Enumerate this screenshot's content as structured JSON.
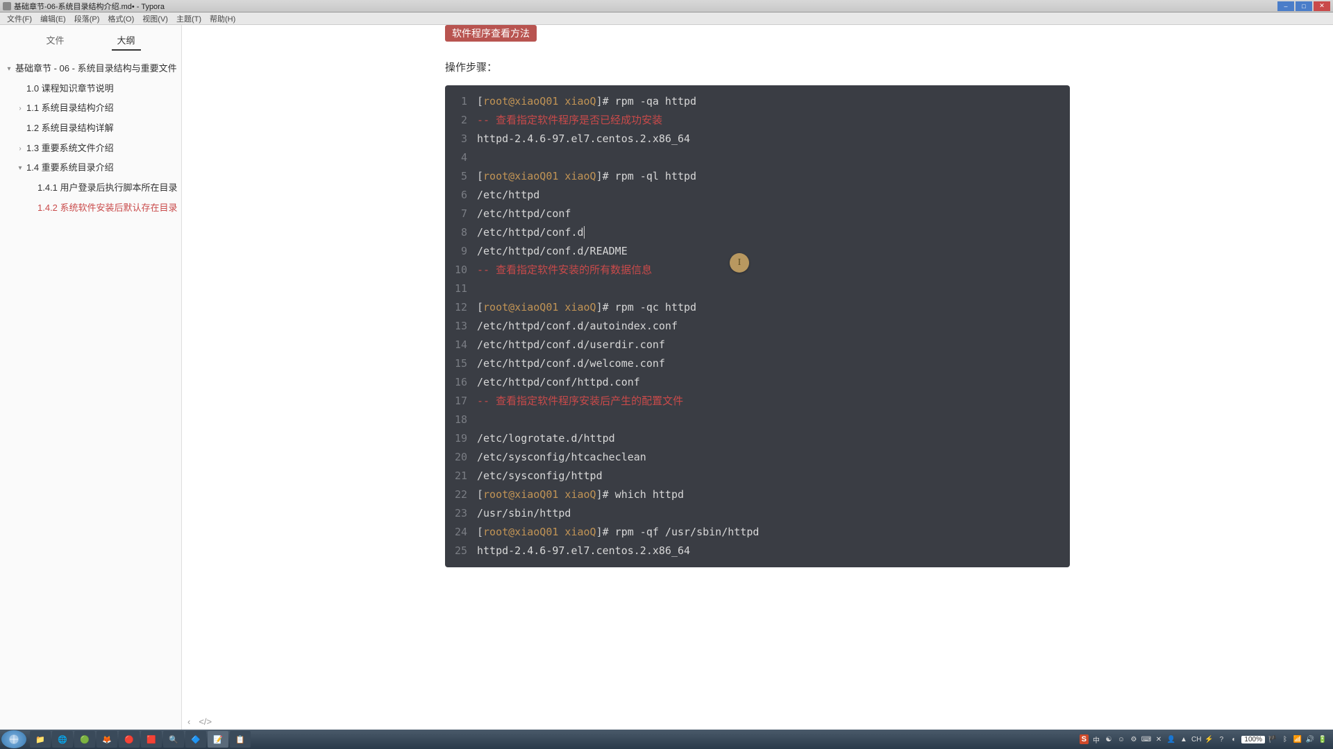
{
  "window": {
    "title": "基础章节-06-系统目录结构介绍.md• - Typora"
  },
  "menubar": [
    "文件(F)",
    "编辑(E)",
    "段落(P)",
    "格式(O)",
    "视图(V)",
    "主题(T)",
    "帮助(H)"
  ],
  "sidebar": {
    "tabs": {
      "files": "文件",
      "outline": "大纲"
    },
    "outline": [
      {
        "text": "基础章节 - 06 - 系统目录结构与重要文件",
        "level": 0,
        "arrow": "▾"
      },
      {
        "text": "1.0 课程知识章节说明",
        "level": 1,
        "arrow": ""
      },
      {
        "text": "1.1 系统目录结构介绍",
        "level": 1,
        "arrow": "›"
      },
      {
        "text": "1.2 系统目录结构详解",
        "level": 1,
        "arrow": ""
      },
      {
        "text": "1.3 重要系统文件介绍",
        "level": 1,
        "arrow": "›"
      },
      {
        "text": "1.4 重要系统目录介绍",
        "level": 1,
        "arrow": "▾"
      },
      {
        "text": "1.4.1 用户登录后执行脚本所在目录",
        "level": 2,
        "arrow": ""
      },
      {
        "text": "1.4.2 系统软件安装后默认存在目录",
        "level": 2,
        "arrow": "",
        "active": true
      }
    ]
  },
  "editor": {
    "badge": "软件程序查看方法",
    "steps_label": "操作步骤：",
    "cursor_badge": "I",
    "code_lines": [
      {
        "n": 1,
        "type": "prompt",
        "cmd": "rpm -qa httpd"
      },
      {
        "n": 2,
        "type": "comment",
        "text": "-- 查看指定软件程序是否已经成功安装"
      },
      {
        "n": 3,
        "type": "plain",
        "text": "httpd-2.4.6-97.el7.centos.2.x86_64"
      },
      {
        "n": 4,
        "type": "plain",
        "text": ""
      },
      {
        "n": 5,
        "type": "prompt",
        "cmd": "rpm -ql httpd"
      },
      {
        "n": 6,
        "type": "plain",
        "text": "/etc/httpd"
      },
      {
        "n": 7,
        "type": "plain",
        "text": "/etc/httpd/conf"
      },
      {
        "n": 8,
        "type": "plain",
        "text": "/etc/httpd/conf.d",
        "cursor": true
      },
      {
        "n": 9,
        "type": "plain",
        "text": "/etc/httpd/conf.d/README"
      },
      {
        "n": 10,
        "type": "comment",
        "text": "-- 查看指定软件安装的所有数据信息"
      },
      {
        "n": 11,
        "type": "plain",
        "text": ""
      },
      {
        "n": 12,
        "type": "prompt",
        "cmd": "rpm -qc httpd"
      },
      {
        "n": 13,
        "type": "plain",
        "text": "/etc/httpd/conf.d/autoindex.conf"
      },
      {
        "n": 14,
        "type": "plain",
        "text": "/etc/httpd/conf.d/userdir.conf"
      },
      {
        "n": 15,
        "type": "plain",
        "text": "/etc/httpd/conf.d/welcome.conf"
      },
      {
        "n": 16,
        "type": "plain",
        "text": "/etc/httpd/conf/httpd.conf"
      },
      {
        "n": 17,
        "type": "comment",
        "text": "-- 查看指定软件程序安装后产生的配置文件"
      },
      {
        "n": 18,
        "type": "plain",
        "text": ""
      },
      {
        "n": 19,
        "type": "plain",
        "text": "/etc/logrotate.d/httpd"
      },
      {
        "n": 20,
        "type": "plain",
        "text": "/etc/sysconfig/htcacheclean"
      },
      {
        "n": 21,
        "type": "plain",
        "text": "/etc/sysconfig/httpd"
      },
      {
        "n": 22,
        "type": "prompt",
        "cmd": "which httpd"
      },
      {
        "n": 23,
        "type": "plain",
        "text": "/usr/sbin/httpd"
      },
      {
        "n": 24,
        "type": "prompt",
        "cmd": "rpm -qf /usr/sbin/httpd"
      },
      {
        "n": 25,
        "type": "plain",
        "text": "httpd-2.4.6-97.el7.centos.2.x86_64"
      }
    ],
    "prompt_user": "root@xiaoQ01 xiaoQ",
    "prompt_suffix": "# "
  },
  "taskbar": {
    "ime": "S",
    "lang": "CH",
    "zoom": "100%"
  }
}
